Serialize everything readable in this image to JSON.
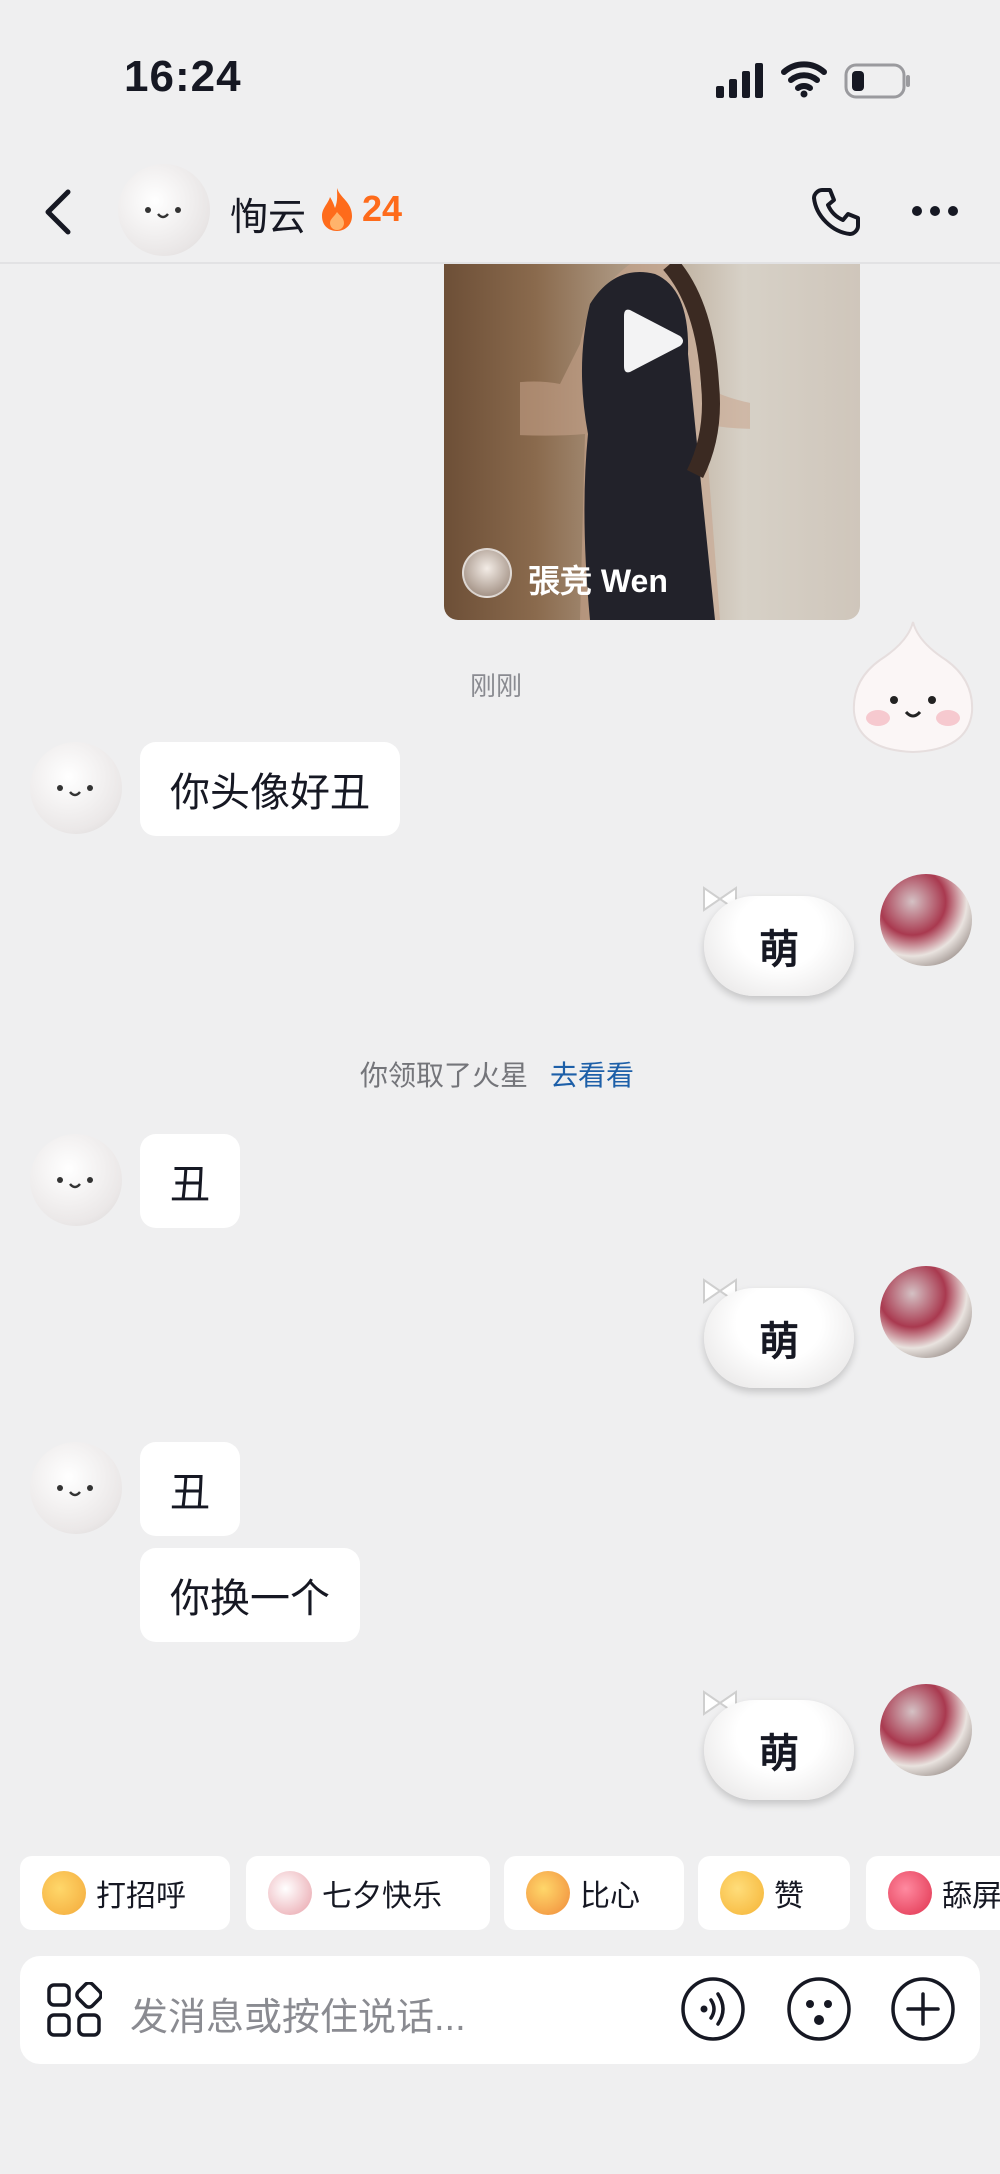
{
  "status_bar": {
    "time": "16:24"
  },
  "header": {
    "contact_name": "恂云",
    "streak_count": "24",
    "streak_color": "#fe6b1b"
  },
  "video_card": {
    "author": "張竞 Wen"
  },
  "timestamp": "刚刚",
  "messages": {
    "m1": "你头像好丑",
    "r1": "萌",
    "system": {
      "text": "你领取了火星",
      "link": "去看看"
    },
    "m2": "丑",
    "r2": "萌",
    "m3": "丑",
    "m4": "你换一个",
    "r3": "萌"
  },
  "quick_replies": [
    {
      "label": "打招呼",
      "icon": "wave-hand-emoji"
    },
    {
      "label": "七夕快乐",
      "icon": "magpie-emoji"
    },
    {
      "label": "比心",
      "icon": "finger-heart-emoji"
    },
    {
      "label": "赞",
      "icon": "thumbs-up-emoji"
    },
    {
      "label": "舔屏",
      "icon": "heart-eyes-emoji"
    }
  ],
  "input": {
    "placeholder": "发消息或按住说话..."
  },
  "colors": {
    "background": "#efeff0",
    "link": "#1d5fa8",
    "accent": "#fe6b1b"
  }
}
